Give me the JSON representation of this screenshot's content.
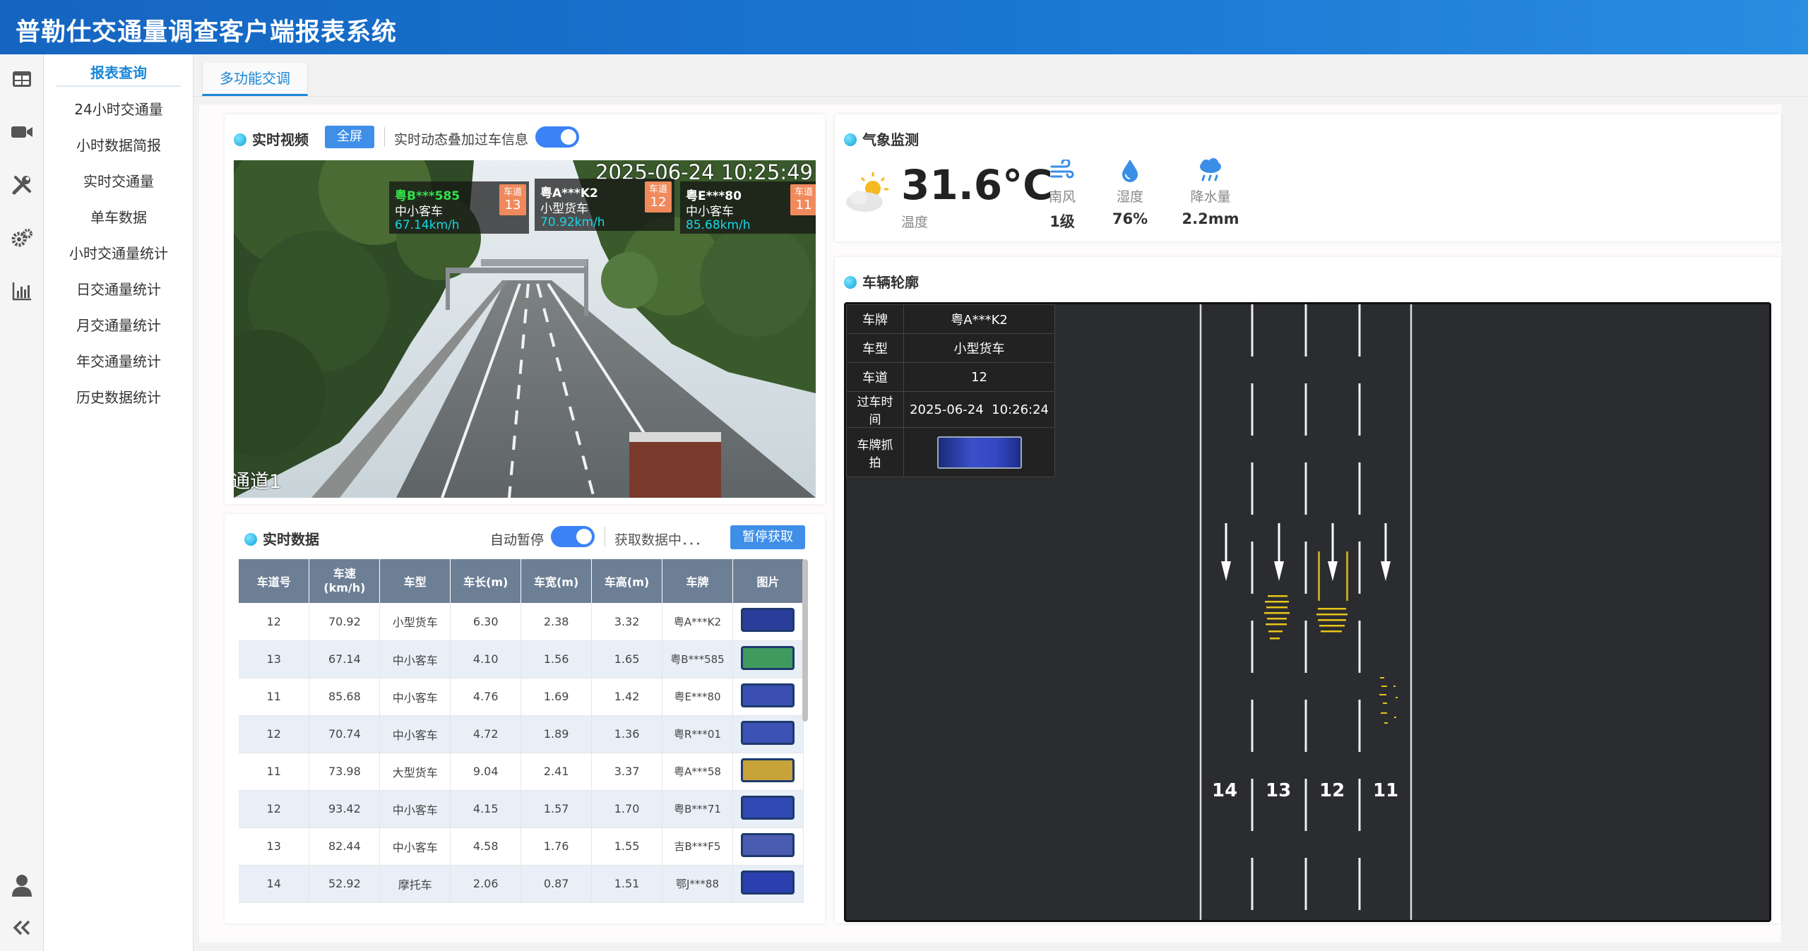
{
  "app": {
    "title": "普勒仕交通量调查客户端报表系统"
  },
  "rail_icons": [
    "table-icon",
    "video-icon",
    "tools-icon",
    "settings-icon",
    "chart-icon"
  ],
  "rail_bottom_icons": [
    "user-icon",
    "collapse-icon"
  ],
  "menu": {
    "header": "报表查询",
    "items": [
      "24小时交通量",
      "小时数据简报",
      "实时交通量",
      "单车数据",
      "小时交通量统计",
      "日交通量统计",
      "月交通量统计",
      "年交通量统计",
      "历史数据统计"
    ]
  },
  "tabs": {
    "active": "多功能交调"
  },
  "video_panel": {
    "title": "实时视频",
    "fullscreen_button": "全屏",
    "overlay_label": "实时动态叠加过车信息",
    "overlay_toggle_on": true,
    "timestamp": "2025-06-24 10:25:49",
    "channel": "通道1",
    "overlays": [
      {
        "plate": "粤B***585",
        "plate_color": "#33e04a",
        "type": "中小客车",
        "speed": "67.14km/h",
        "lane_label": "车道",
        "lane": "13"
      },
      {
        "plate": "粤A***K2",
        "plate_color": "#ffffff",
        "type": "小型货车",
        "speed": "70.92km/h",
        "lane_label": "车道",
        "lane": "12"
      },
      {
        "plate": "粤E***80",
        "plate_color": "#ffffff",
        "type": "中小客车",
        "speed": "85.68km/h",
        "lane_label": "车道",
        "lane": "11"
      }
    ]
  },
  "data_panel": {
    "title": "实时数据",
    "auto_pause_label": "自动暂停",
    "auto_pause_on": true,
    "status": "获取数据中．．．",
    "pause_button": "暂停获取",
    "columns": [
      "车道号",
      "车速\n(km/h)",
      "车型",
      "车长(m)",
      "车宽(m)",
      "车高(m)",
      "车牌",
      "图片"
    ],
    "rows": [
      {
        "lane": "12",
        "speed": "70.92",
        "type": "小型货车",
        "length": "6.30",
        "width": "2.38",
        "height": "3.32",
        "plate": "粤A***K2",
        "pic_color": "#2a3d9a"
      },
      {
        "lane": "13",
        "speed": "67.14",
        "type": "中小客车",
        "length": "4.10",
        "width": "1.56",
        "height": "1.65",
        "plate": "粤B***585",
        "pic_color": "#3f9a5e"
      },
      {
        "lane": "11",
        "speed": "85.68",
        "type": "中小客车",
        "length": "4.76",
        "width": "1.69",
        "height": "1.42",
        "plate": "粤E***80",
        "pic_color": "#3a4fb0"
      },
      {
        "lane": "12",
        "speed": "70.74",
        "type": "中小客车",
        "length": "4.72",
        "width": "1.89",
        "height": "1.36",
        "plate": "粤R***01",
        "pic_color": "#3d52b5"
      },
      {
        "lane": "11",
        "speed": "73.98",
        "type": "大型货车",
        "length": "9.04",
        "width": "2.41",
        "height": "3.37",
        "plate": "粤A***58",
        "pic_color": "#c8a33a"
      },
      {
        "lane": "12",
        "speed": "93.42",
        "type": "中小客车",
        "length": "4.15",
        "width": "1.57",
        "height": "1.70",
        "plate": "粤B***71",
        "pic_color": "#2f48b2"
      },
      {
        "lane": "13",
        "speed": "82.44",
        "type": "中小客车",
        "length": "4.58",
        "width": "1.76",
        "height": "1.55",
        "plate": "吉B***F5",
        "pic_color": "#4a5cb0"
      },
      {
        "lane": "14",
        "speed": "52.92",
        "type": "摩托车",
        "length": "2.06",
        "width": "0.87",
        "height": "1.51",
        "plate": "鄂J***88",
        "pic_color": "#2b3fae"
      }
    ]
  },
  "weather_panel": {
    "title": "气象监测",
    "temperature": "31.6°C",
    "temperature_label": "温度",
    "metrics": [
      {
        "icon": "wind-icon",
        "label": "南风",
        "value": "1级"
      },
      {
        "icon": "humidity-icon",
        "label": "湿度",
        "value": "76%"
      },
      {
        "icon": "rain-icon",
        "label": "降水量",
        "value": "2.2mm"
      }
    ]
  },
  "profile_panel": {
    "title": "车辆轮廓",
    "info": [
      {
        "key": "车牌",
        "value": "粤A***K2"
      },
      {
        "key": "车型",
        "value": "小型货车"
      },
      {
        "key": "车道",
        "value": "12"
      },
      {
        "key": "过车时间",
        "value": "2025-06-24  10:26:24"
      },
      {
        "key": "车牌抓拍",
        "value": ""
      }
    ],
    "lanes": [
      "14",
      "13",
      "12",
      "11"
    ]
  }
}
